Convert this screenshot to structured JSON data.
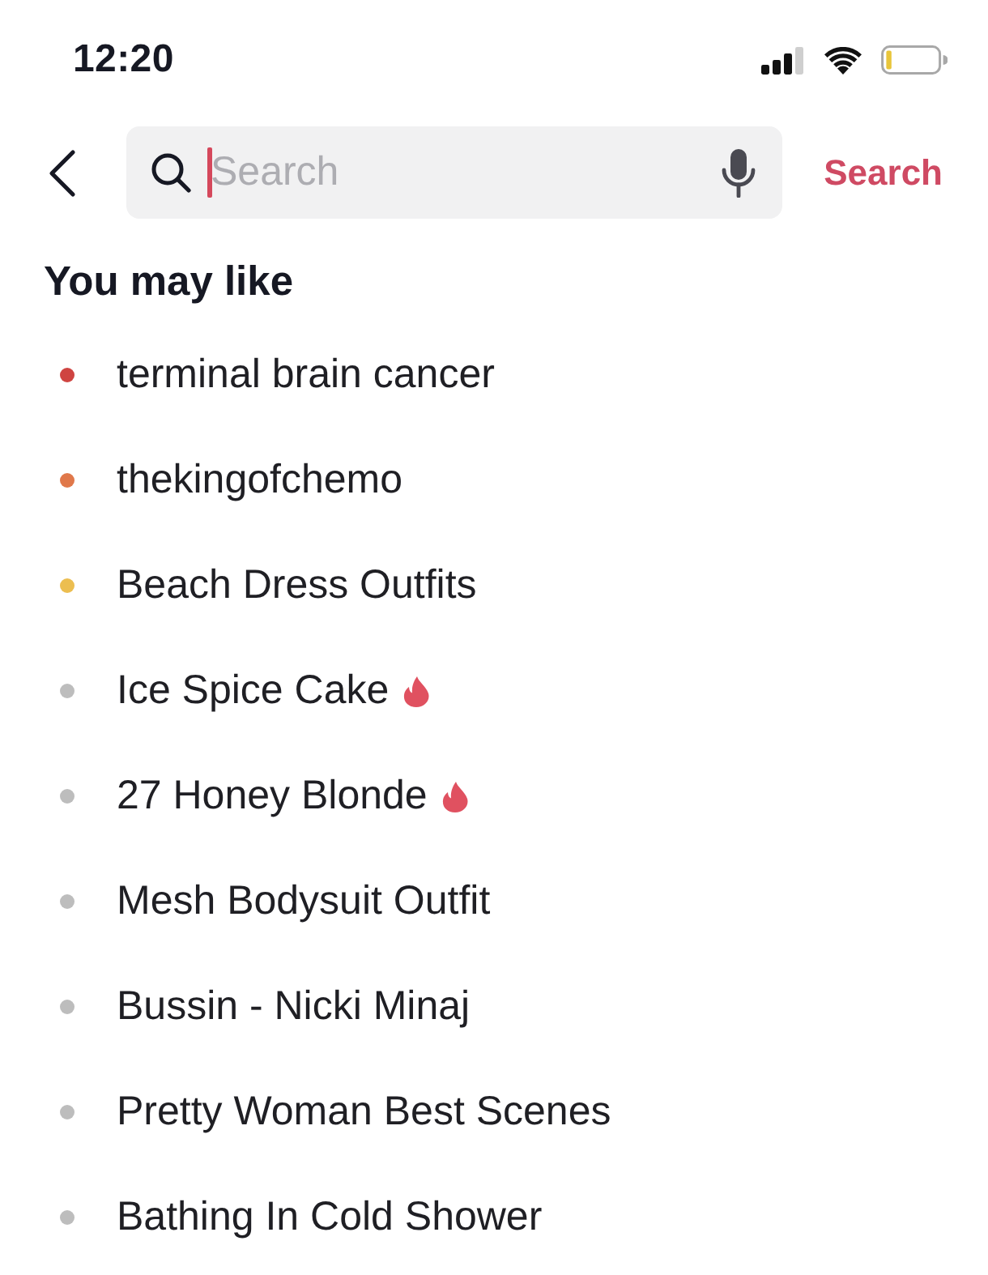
{
  "status_bar": {
    "time": "12:20"
  },
  "search": {
    "placeholder": "Search",
    "focused": true,
    "button": "Search"
  },
  "suggestions": {
    "title": "You may like",
    "items": [
      {
        "label": "terminal brain cancer",
        "color": "#cf4441",
        "trending": false
      },
      {
        "label": "thekingofchemo",
        "color": "#e0784a",
        "trending": false
      },
      {
        "label": "Beach Dress Outfits",
        "color": "#ecbe50",
        "trending": false
      },
      {
        "label": "Ice Spice Cake",
        "color": "#bdbdbd",
        "trending": true
      },
      {
        "label": "27 Honey Blonde",
        "color": "#bdbdbd",
        "trending": true
      },
      {
        "label": "Mesh Bodysuit Outfit",
        "color": "#bdbdbd",
        "trending": false
      },
      {
        "label": "Bussin - Nicki Minaj",
        "color": "#bdbdbd",
        "trending": false
      },
      {
        "label": "Pretty Woman Best Scenes",
        "color": "#bdbdbd",
        "trending": false
      },
      {
        "label": "Bathing In Cold Shower",
        "color": "#bdbdbd",
        "trending": false
      }
    ]
  }
}
